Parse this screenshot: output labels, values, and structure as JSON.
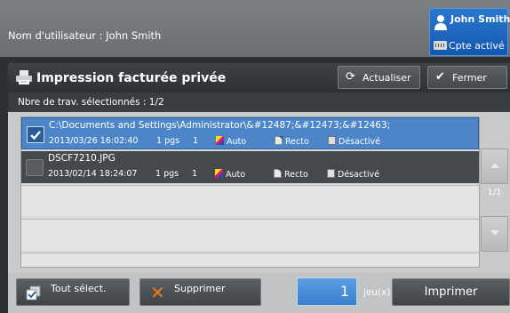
{
  "header": {
    "user_label": "Nom d'utilisateur : John Smith",
    "login_name": "John Smith",
    "login_status": "Cpte activé"
  },
  "panel": {
    "title": "Impression facturée privée",
    "refresh_label": "Actualiser",
    "close_label": "Fermer",
    "selected_count": "Nbre de trav. sélectionnés : 1/2"
  },
  "jobs": [
    {
      "name": "C:\\Documents and Settings\\Administrator\\&#12487;&#12473;&#12463;",
      "date": "2013/03/26 16:02:40",
      "pages": "1 pgs",
      "copies": "1",
      "color": "Auto",
      "sides": "Recto",
      "staple": "Désactivé",
      "selected": true
    },
    {
      "name": "DSCF7210.JPG",
      "date": "2013/02/14 18:24:07",
      "pages": "1 pgs",
      "copies": "1",
      "color": "Auto",
      "sides": "Recto",
      "staple": "Désactivé",
      "selected": false
    }
  ],
  "pagination": {
    "indicator": "1/1"
  },
  "footer": {
    "select_all_label": "Tout sélect.",
    "delete_label": "Supprimer",
    "quantity": "1",
    "quantity_unit": "jeu(x)",
    "print_label": "Imprimer"
  },
  "colors": {
    "selected_row": "#4c86c9",
    "unselected_row": "#45494d",
    "accent_blue": "#3a7fcd",
    "delete_icon": "#f07a1a"
  }
}
